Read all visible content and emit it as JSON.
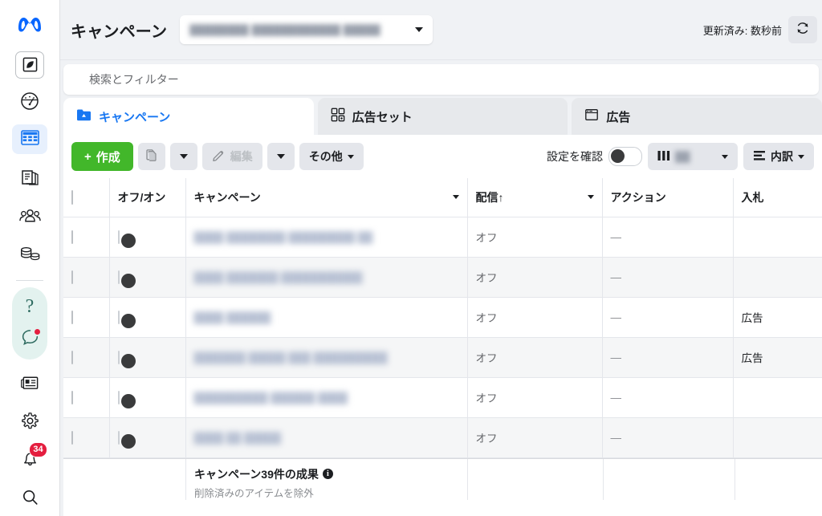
{
  "app": {
    "brand": "meta-logo",
    "accent_blue": "#1877f2",
    "create_green": "#42b72a",
    "badge_red": "#e41e3f"
  },
  "sidebar": {
    "items": [
      {
        "icon": "meta-logo-icon",
        "label": ""
      },
      {
        "icon": "leaf-icon",
        "label": ""
      },
      {
        "icon": "gauge-icon",
        "label": ""
      },
      {
        "icon": "table-icon",
        "label": "",
        "active": true
      },
      {
        "icon": "pages-icon",
        "label": ""
      },
      {
        "icon": "audience-icon",
        "label": ""
      },
      {
        "icon": "billing-icon",
        "label": ""
      },
      {
        "icon": "help-icon",
        "label": ""
      },
      {
        "icon": "chat-icon",
        "label": ""
      },
      {
        "icon": "news-icon",
        "label": ""
      },
      {
        "icon": "settings-gear-icon",
        "label": ""
      },
      {
        "icon": "bell-icon",
        "label": "",
        "badge": "34"
      },
      {
        "icon": "search-icon",
        "label": ""
      }
    ],
    "notification_count": "34"
  },
  "header": {
    "title": "キャンペーン",
    "account_value": "████████ ████████████ █████",
    "updated_label": "更新済み: 数秒前",
    "refresh_icon": "refresh-icon"
  },
  "search": {
    "placeholder": "検索とフィルター",
    "icon": "search-icon"
  },
  "tabs": [
    {
      "label": "キャンペーン",
      "icon": "campaign-folder-icon",
      "active": true
    },
    {
      "label": "広告セット",
      "icon": "adset-grid-icon",
      "active": false
    },
    {
      "label": "広告",
      "icon": "ad-window-icon",
      "active": false
    }
  ],
  "toolbar": {
    "create_label": "作成",
    "create_plus": "+",
    "duplicate_icon": "duplicate-icon",
    "duplicate_caret": "chevron-down-icon",
    "edit_label": "編集",
    "edit_icon": "pencil-icon",
    "edit_caret": "chevron-down-icon",
    "more_label": "その他",
    "more_caret": "chevron-down-icon",
    "review_label": "設定を確認",
    "review_toggle_state": "off",
    "columns_label": "██",
    "columns_icon": "columns-icon",
    "columns_caret": "chevron-down-icon",
    "breakdown_label": "内訳",
    "breakdown_icon": "breakdown-icon",
    "breakdown_caret": "chevron-down-icon"
  },
  "table": {
    "columns": [
      {
        "key": "check",
        "label": "",
        "sorted": false
      },
      {
        "key": "onoff",
        "label": "オフ/オン",
        "sorted": false
      },
      {
        "key": "campaign",
        "label": "キャンペーン",
        "sorted": false,
        "menu": true
      },
      {
        "key": "delivery",
        "label": "配信↑",
        "sorted": true,
        "menu": true
      },
      {
        "key": "action",
        "label": "アクション",
        "sorted": false
      },
      {
        "key": "bid",
        "label": "入札",
        "sorted": false
      }
    ],
    "rows": [
      {
        "toggle": "off",
        "name": "████ ████████ █████████ ██",
        "delivery": "オフ",
        "action": "—",
        "bid": ""
      },
      {
        "toggle": "off",
        "name": "████ ███████ ███████████",
        "delivery": "オフ",
        "action": "—",
        "bid": ""
      },
      {
        "toggle": "off",
        "name": "████ ██████",
        "delivery": "オフ",
        "action": "—",
        "bid": "広告"
      },
      {
        "toggle": "off",
        "name": "███████ █████ ███ ██████████",
        "delivery": "オフ",
        "action": "—",
        "bid": "広告"
      },
      {
        "toggle": "off",
        "name": "██████████ ██████ ████",
        "delivery": "オフ",
        "action": "—",
        "bid": ""
      },
      {
        "toggle": "off",
        "name": "████ ██ █████",
        "delivery": "オフ",
        "action": "—",
        "bid": ""
      }
    ],
    "summary": {
      "title": "キャンペーン39件の成果",
      "info_icon": "info-icon",
      "subtitle": "削除済みのアイテムを除外"
    }
  }
}
